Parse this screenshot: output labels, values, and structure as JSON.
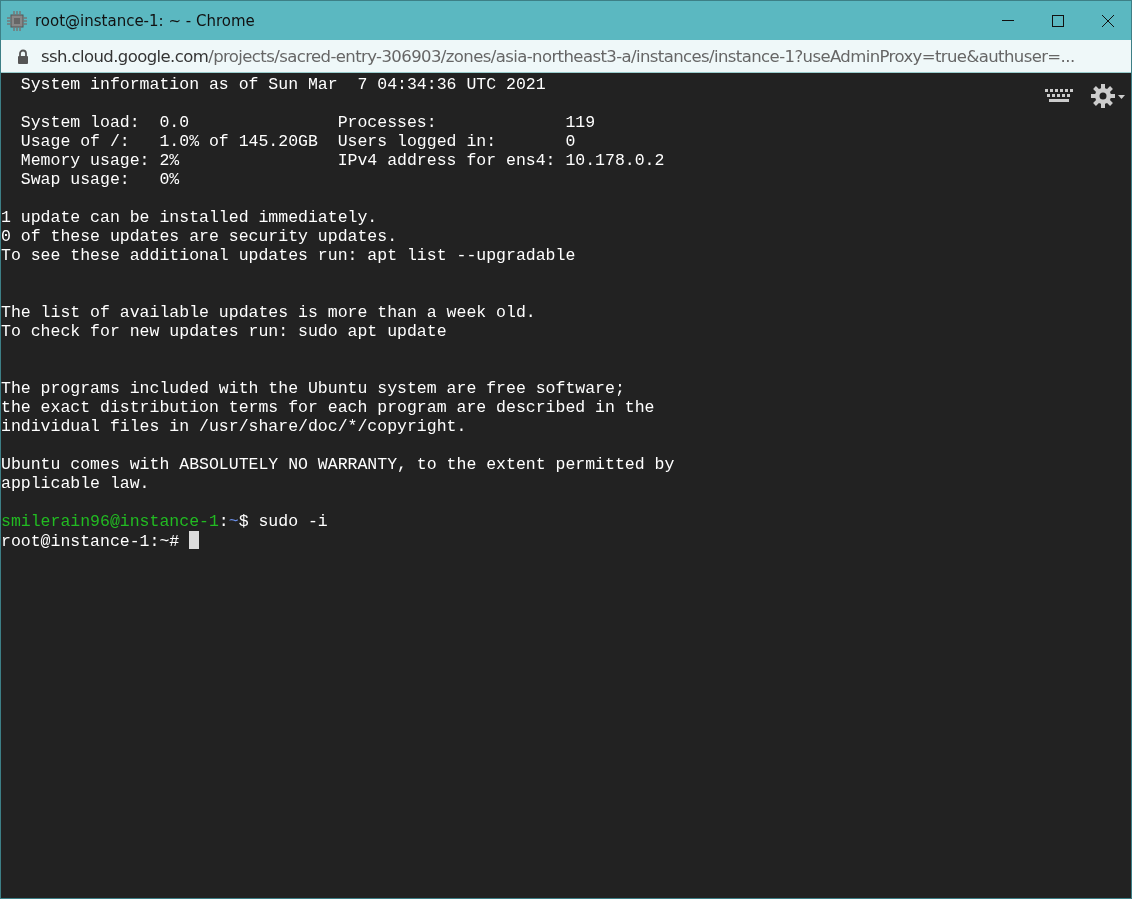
{
  "window": {
    "title": "root@instance-1: ~ - Chrome"
  },
  "address_bar": {
    "host": "ssh.cloud.google.com",
    "path": "/projects/sacred-entry-306903/zones/asia-northeast3-a/instances/instance-1?useAdminProxy=true&authuser=..."
  },
  "terminal": {
    "lines": [
      {
        "kind": "output",
        "text": "  System information as of Sun Mar  7 04:34:36 UTC 2021"
      },
      {
        "kind": "blank"
      },
      {
        "kind": "output",
        "text": "  System load:  0.0               Processes:             119"
      },
      {
        "kind": "output",
        "text": "  Usage of /:   1.0% of 145.20GB  Users logged in:       0"
      },
      {
        "kind": "output",
        "text": "  Memory usage: 2%                IPv4 address for ens4: 10.178.0.2"
      },
      {
        "kind": "output",
        "text": "  Swap usage:   0%"
      },
      {
        "kind": "blank"
      },
      {
        "kind": "output",
        "text": "1 update can be installed immediately."
      },
      {
        "kind": "output",
        "text": "0 of these updates are security updates."
      },
      {
        "kind": "output",
        "text": "To see these additional updates run: apt list --upgradable"
      },
      {
        "kind": "blank"
      },
      {
        "kind": "blank"
      },
      {
        "kind": "output",
        "text": "The list of available updates is more than a week old."
      },
      {
        "kind": "output",
        "text": "To check for new updates run: sudo apt update"
      },
      {
        "kind": "blank"
      },
      {
        "kind": "blank"
      },
      {
        "kind": "output",
        "text": "The programs included with the Ubuntu system are free software;"
      },
      {
        "kind": "output",
        "text": "the exact distribution terms for each program are described in the"
      },
      {
        "kind": "output",
        "text": "individual files in /usr/share/doc/*/copyright."
      },
      {
        "kind": "blank"
      },
      {
        "kind": "output",
        "text": "Ubuntu comes with ABSOLUTELY NO WARRANTY, to the extent permitted by"
      },
      {
        "kind": "output",
        "text": "applicable law."
      },
      {
        "kind": "blank"
      },
      {
        "kind": "prompt",
        "user_host": "smilerain96@instance-1",
        "separator": ":",
        "path": "~",
        "command": "$ sudo -i"
      },
      {
        "kind": "root_prompt",
        "text": "root@instance-1:~# ",
        "cursor": true
      }
    ]
  }
}
